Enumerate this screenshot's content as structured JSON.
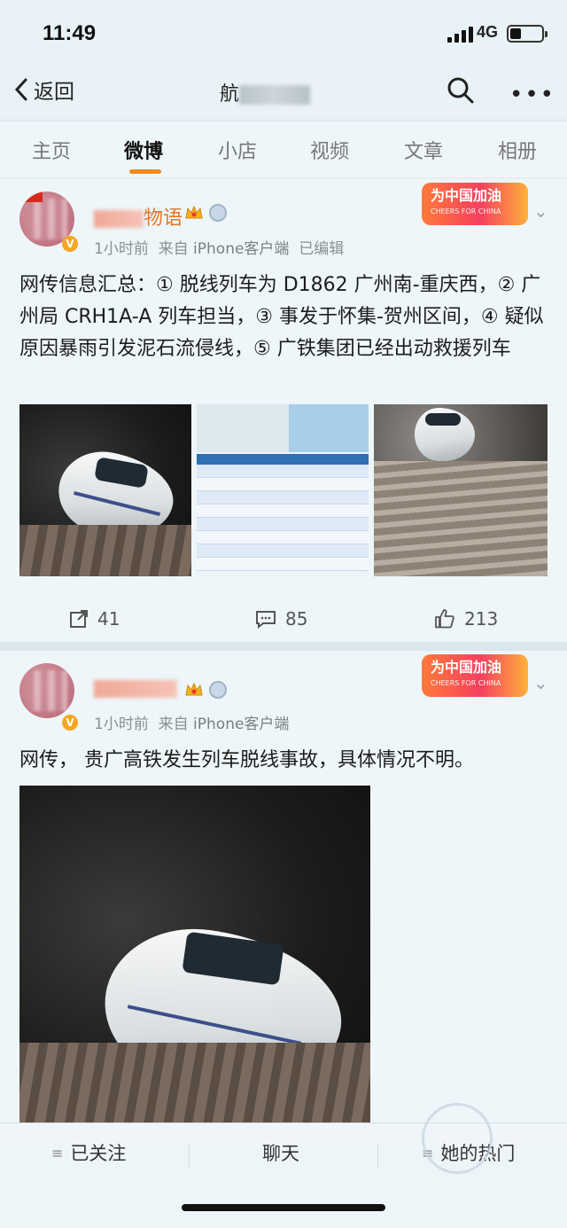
{
  "status": {
    "time": "11:49",
    "network": "4G"
  },
  "nav": {
    "back_label": "返回",
    "title_visible": "航"
  },
  "tabs": [
    {
      "label": "主页",
      "active": false
    },
    {
      "label": "微博",
      "active": true
    },
    {
      "label": "小店",
      "active": false
    },
    {
      "label": "视频",
      "active": false
    },
    {
      "label": "文章",
      "active": false
    },
    {
      "label": "相册",
      "active": false
    }
  ],
  "posts": [
    {
      "username_visible": "物语",
      "time_ago": "1小时前",
      "source_prefix": "来自",
      "source": "iPhone客户端",
      "edited": "已编辑",
      "promo": {
        "title": "为中国加油",
        "subtitle": "CHEERS FOR CHINA"
      },
      "text": "网传信息汇总：① 脱线列车为 D1862 广州南-重庆西，② 广州局 CRH1A-A 列车担当，③ 事发于怀集-贺州区间，④ 疑似原因暴雨引发泥石流侵线，⑤ 广铁集团已经出动救援列车",
      "reposts": "41",
      "comments": "85",
      "likes": "213"
    },
    {
      "time_ago": "1小时前",
      "source_prefix": "来自",
      "source": "iPhone客户端",
      "promo": {
        "title": "为中国加油",
        "subtitle": "CHEERS FOR CHINA"
      },
      "text": "网传， 贵广高铁发生列车脱线事故，具体情况不明。"
    }
  ],
  "bottom": {
    "followed": "已关注",
    "chat": "聊天",
    "hot": "她的热门"
  },
  "colors": {
    "accent": "#f08a1c",
    "username": "#e2762b",
    "background": "#e4eef3"
  }
}
